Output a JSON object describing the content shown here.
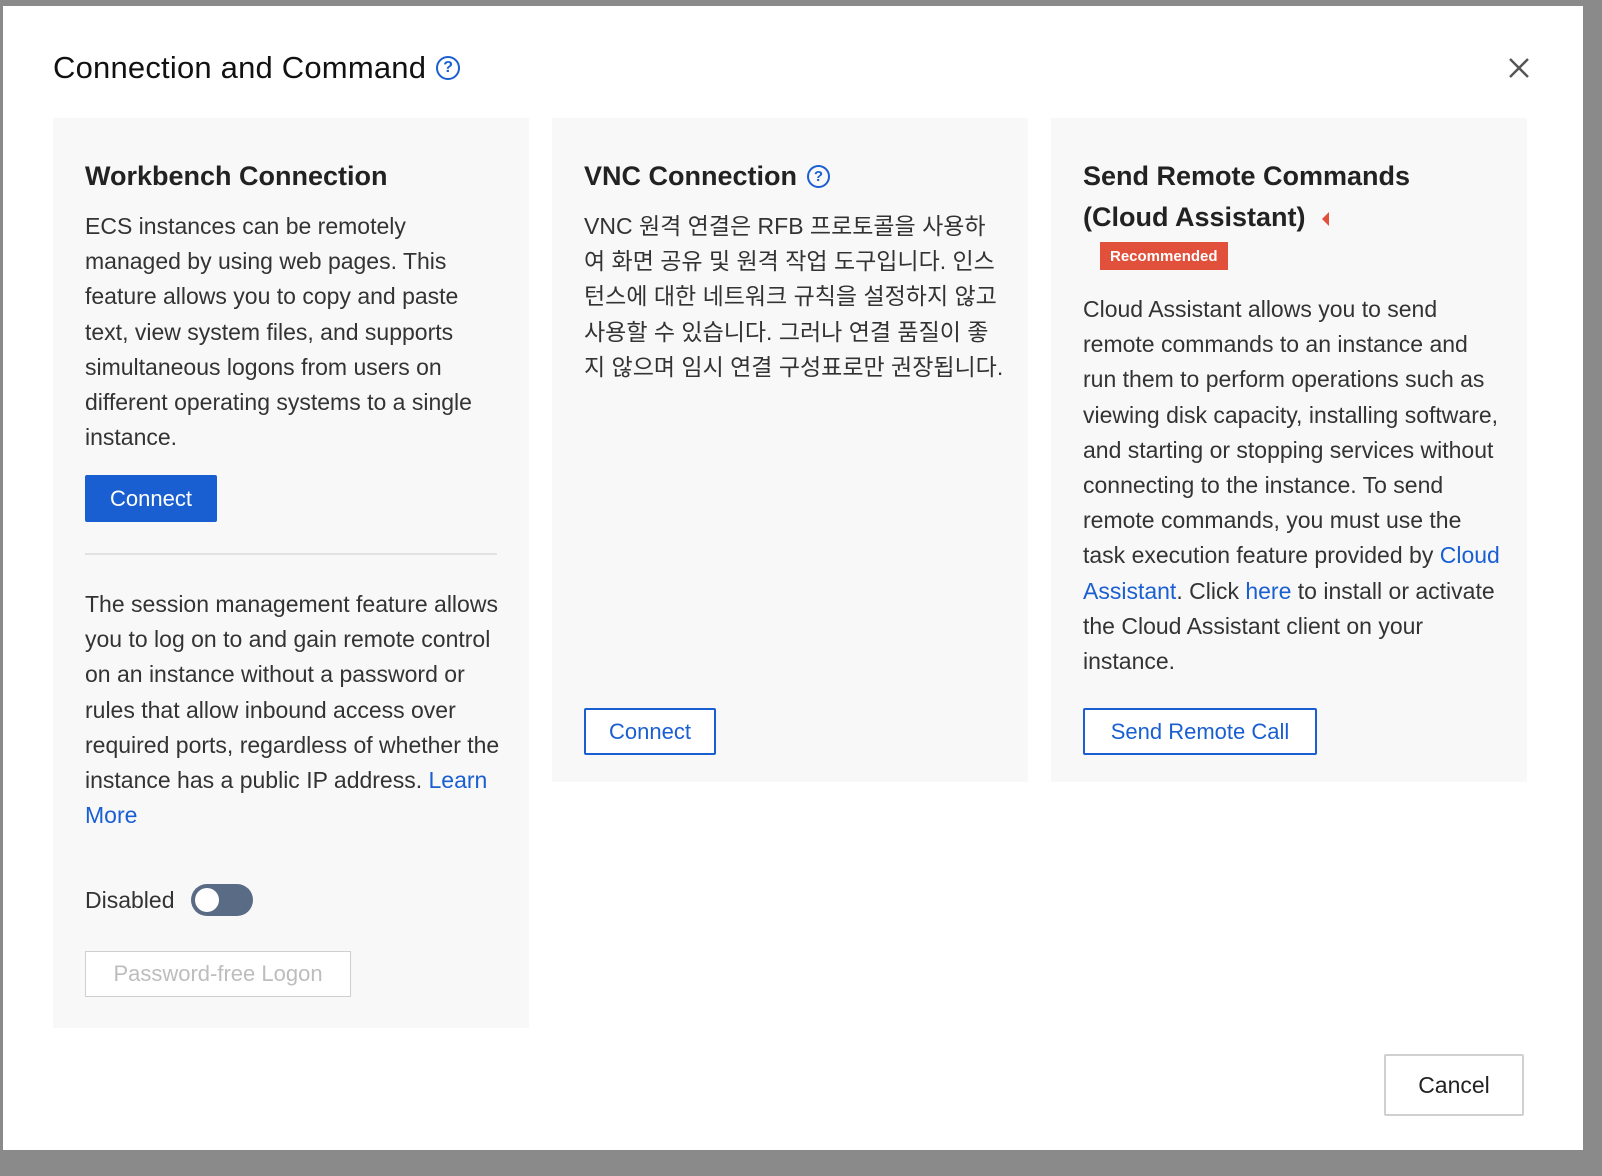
{
  "modal": {
    "title": "Connection and Command",
    "help_icon": "?",
    "close_icon": "close-icon",
    "cancel_label": "Cancel"
  },
  "workbench": {
    "title": "Workbench Connection",
    "description": "ECS instances can be remotely managed by using web pages. This feature allows you to copy and paste text, view system files, and supports simultaneous logons from users on different operating systems to a single instance.",
    "connect_label": "Connect",
    "session_description": "The session management feature allows you to log on to and gain remote control on an instance without a password or rules that allow inbound access over required ports, regardless of whether the instance has a public IP address.",
    "learn_more": "Learn More",
    "toggle_label": "Disabled",
    "password_free_label": "Password-free Logon"
  },
  "vnc": {
    "title": "VNC Connection",
    "description": "VNC 원격 연결은 RFB 프로토콜을 사용하여 화면 공유 및 원격 작업 도구입니다. 인스턴스에 대한 네트워크 규칙을 설정하지 않고 사용할 수 있습니다. 그러나 연결 품질이 좋지 않으며 임시 연결 구성표로만 권장됩니다.",
    "connect_label": "Connect"
  },
  "remote": {
    "title": "Send Remote Commands (Cloud Assistant)",
    "badge": "Recommended",
    "desc_part1": "Cloud Assistant allows you to send remote commands to an instance and run them to perform operations such as viewing disk capacity, installing software, and starting or stopping services without connecting to the instance. To send remote commands, you must use the task execution feature provided by ",
    "link_cloud_assistant": "Cloud Assistant",
    "desc_part2": ". Click ",
    "link_here": "here",
    "desc_part3": " to install or activate the Cloud Assistant client on your instance.",
    "send_label": "Send Remote Call"
  },
  "colors": {
    "primary": "#1a5fd1",
    "badge": "#e0503a",
    "panel_bg": "#f8f8f8"
  }
}
